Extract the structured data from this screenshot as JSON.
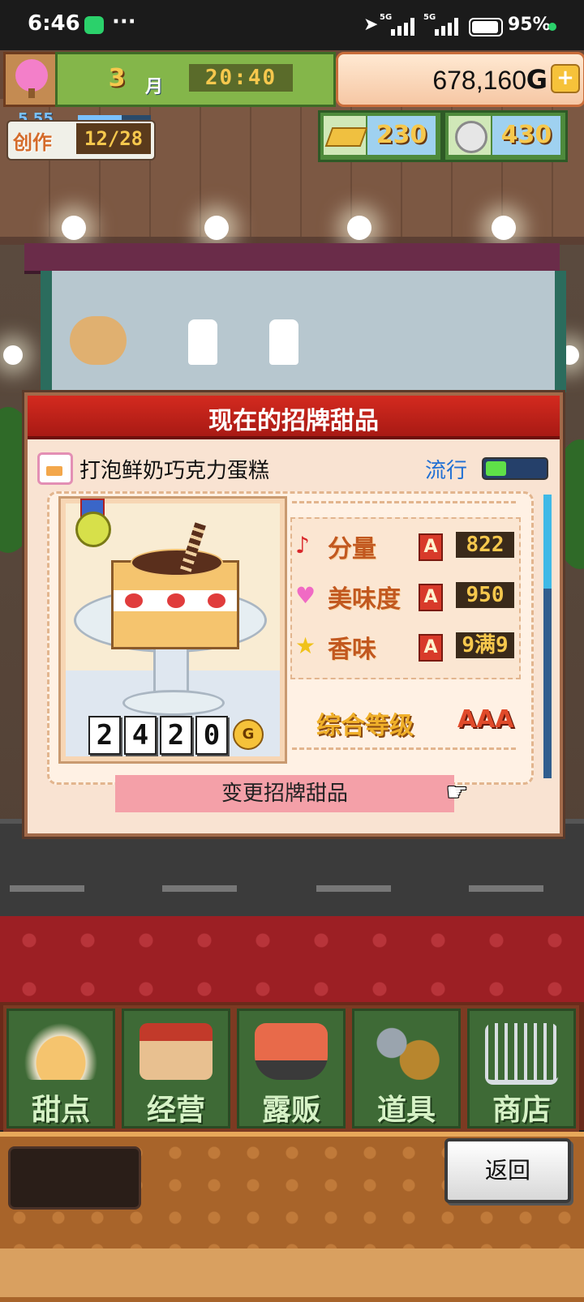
{
  "status_bar": {
    "time": "6:46",
    "more": "···",
    "signal1": "5G",
    "signal2": "5G",
    "battery_pct": "95%"
  },
  "hud": {
    "month": "3",
    "month_unit": "月",
    "clock": "20:40",
    "money": "678,160",
    "money_unit": "G",
    "add_label": "+",
    "create_label": "创作",
    "create_count": "12/28",
    "level_text": "5 55",
    "level_progress": 0.6,
    "gold_bars": "230",
    "medals": "430"
  },
  "dialog": {
    "title": "现在的招牌甜品",
    "dessert_name": "打泡鲜奶巧克力蛋糕",
    "trend_label": "流行",
    "trend_level": 0.35,
    "price_digits": [
      "2",
      "4",
      "2",
      "0"
    ],
    "price_unit": "G",
    "stats": [
      {
        "icon": "music-note-icon",
        "glyph": "♪",
        "color": "#d8262a",
        "name": "分量",
        "grade": "A",
        "value": "822"
      },
      {
        "icon": "heart-icon",
        "glyph": "♥",
        "color": "#f06ac4",
        "name": "美味度",
        "grade": "A",
        "value": "950"
      },
      {
        "icon": "star-icon",
        "glyph": "★",
        "color": "#f0c21a",
        "name": "香味",
        "grade": "A",
        "value": "9满9"
      }
    ],
    "overall_label": "综合等级",
    "overall_value": "AAA",
    "change_button": "变更招牌甜品"
  },
  "menu": [
    {
      "id": "dessert",
      "label": "甜点",
      "icon": "cake-icon"
    },
    {
      "id": "manage",
      "label": "经营",
      "icon": "shop-icon"
    },
    {
      "id": "stall",
      "label": "露贩",
      "icon": "food-truck-icon"
    },
    {
      "id": "tools",
      "label": "道具",
      "icon": "gear-bag-icon"
    },
    {
      "id": "store",
      "label": "商店",
      "icon": "cart-icon"
    }
  ],
  "footer": {
    "back_button": "返回"
  }
}
